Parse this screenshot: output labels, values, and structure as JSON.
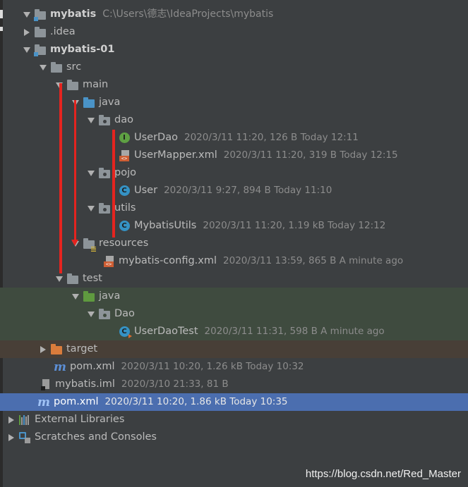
{
  "tree": {
    "project": {
      "name": "mybatis",
      "path": "C:\\Users\\德志\\IdeaProjects\\mybatis"
    },
    "idea": {
      "name": ".idea"
    },
    "module": {
      "name": "mybatis-01"
    },
    "src": {
      "name": "src"
    },
    "main": {
      "name": "main"
    },
    "main_java": {
      "name": "java"
    },
    "dao": {
      "name": "dao"
    },
    "userdao": {
      "name": "UserDao",
      "meta": "2020/3/11 11:20, 126 B Today 12:11",
      "icon_letter": "I"
    },
    "usermapper": {
      "name": "UserMapper.xml",
      "meta": "2020/3/11 11:20, 319 B Today 12:15"
    },
    "pojo": {
      "name": "pojo"
    },
    "user": {
      "name": "User",
      "meta": "2020/3/11 9:27, 894 B Today 11:10",
      "icon_letter": "C"
    },
    "utils": {
      "name": "utils"
    },
    "mybatisutils": {
      "name": "MybatisUtils",
      "meta": "2020/3/11 11:20, 1.19 kB Today 12:12",
      "icon_letter": "C"
    },
    "resources": {
      "name": "resources"
    },
    "config": {
      "name": "mybatis-config.xml",
      "meta": "2020/3/11 13:59, 865 B A minute ago"
    },
    "test": {
      "name": "test"
    },
    "test_java": {
      "name": "java"
    },
    "test_dao": {
      "name": "Dao"
    },
    "userdaotest": {
      "name": "UserDaoTest",
      "meta": "2020/3/11 11:31, 598 B A minute ago",
      "icon_letter": "C"
    },
    "target": {
      "name": "target"
    },
    "module_pom": {
      "name": "pom.xml",
      "meta": "2020/3/11 10:20, 1.26 kB Today 10:32",
      "icon_letter": "m"
    },
    "iml": {
      "name": "mybatis.iml",
      "meta": "2020/3/10 21:33, 81 B"
    },
    "root_pom": {
      "name": "pom.xml",
      "meta": "2020/3/11 10:20, 1.86 kB Today 10:35",
      "icon_letter": "m"
    },
    "external_libraries": {
      "name": "External Libraries"
    },
    "scratches": {
      "name": "Scratches and Consoles"
    }
  },
  "watermark": "https://blog.csdn.net/Red_Master",
  "colors": {
    "background": "#3c3f41",
    "selection": "#4b6eaf",
    "test_row_bg": "#3f4b3f",
    "excluded_row_bg": "#483f37",
    "annotation_red": "#e5241f",
    "source_folder": "#4a93c7",
    "test_folder": "#5f9a3f",
    "excluded_folder": "#d97c3c"
  },
  "icons": {
    "folder": "folder-icon",
    "module": "module-folder-icon",
    "package": "package-icon",
    "interface": "interface-icon",
    "class": "class-icon",
    "xml": "xml-file-icon",
    "maven": "maven-pom-icon",
    "iml": "iml-file-icon",
    "libraries": "library-icon",
    "scratches": "scratches-icon"
  }
}
